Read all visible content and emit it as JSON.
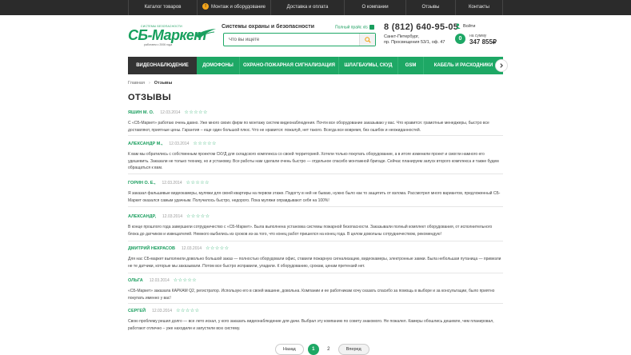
{
  "topnav": [
    {
      "label": "Каталог товаров"
    },
    {
      "label": "Монтаж и оборудование",
      "badge": "!"
    },
    {
      "label": "Доставка и оплата"
    },
    {
      "label": "О компании"
    },
    {
      "label": "Отзывы"
    },
    {
      "label": "Контакты"
    }
  ],
  "logo": {
    "top": "СИСТЕМЫ БЕЗОПАСНОСТИ",
    "main": "СБ-Маркет",
    "sub": "работаем с 2006 года"
  },
  "header": {
    "tagline": "Системы охраны и безопасности",
    "price_link": "Полный прайс xls",
    "phone": "8 (812) 640-95-05",
    "address_line1": "Санкт-Петербург,",
    "address_line2": "пр. Просвещения 53/1, оф. 47",
    "login": "Войти",
    "cart_label": "на сумму",
    "cart_sum": "347 855₽",
    "cart_count": "0"
  },
  "search": {
    "placeholder": "Что вы ищете"
  },
  "catnav": [
    {
      "label": "ВИДЕОНАБЛЮДЕНИЕ"
    },
    {
      "label": "ДОМОФОНЫ"
    },
    {
      "label": "ОХРАНО-ПОЖАРНАЯ СИГНАЛИЗАЦИЯ"
    },
    {
      "label": "ШЛАГБАУМЫ, СКУД"
    },
    {
      "label": "GSM"
    },
    {
      "label": "КАБЕЛЬ И РАСХОДНИКИ"
    }
  ],
  "breadcrumb": {
    "home": "Главная",
    "current": "Отзывы"
  },
  "page_title": "ОТЗЫВЫ",
  "reviews": [
    {
      "author": "ЯШИН М. О.",
      "date": "12.03.2014",
      "rating": 5,
      "text": "С «СБ-Маркет» работаю очень давно. Уже много своих фирм по монтажу систем видеонаблюдения. Почти все оборудование заказываю у вас. Что нравится: грамотные менеджеры, быстро все доставляют, приятные цены. Гарантия – еще один большой плюс. Что не нравится: пожалуй, нет такого. Всегда все вовремя, без ошибок и неожиданностей."
    },
    {
      "author": "АЛЕКСАНДР М.,",
      "date": "12.03.2014",
      "rating": 5,
      "text": "К вам мы обратились с собственным проектом СКУД для складского комплекса со своей территорией. Хотели только покупать оборудование, а в итоге изменили проект и смогли намного его удешевить. Заказали не только технику, но и установку. Все работы нам сделали очень быстро — отдельное спасибо монтажной бригаде. Сейчас планируем запуск второго комплекса и также будем обращаться к вам."
    },
    {
      "author": "ГОРИН О. Е.,",
      "date": "12.03.2014",
      "rating": 5,
      "text": "Я заказал фальшивые видеокамеры, муляжи для своей квартиры на первом этаже. Подогту в ней не бываю, нужно было как то защитить от взлома. Рассмотрел много вариантов, предложенный СБ-Маркет оказался самым удачным. Получилось быстро, недорого. Пока муляжи оправдывают себя на 100%!"
    },
    {
      "author": "АЛЕКСАНДР,",
      "date": "12.03.2014",
      "rating": 5,
      "text": "В конце прошлого года завершили сотрудничество с «СБ-Маркет». Была выполнена установка системы пожарной безопасности. Заказывали полный комплект оборудования, от исполнительного блока до датчиков и извещателей. Немного выбились из сроков из-за того, что конец работ пришелся на конец года. В целом довольны сотрудничеством, рекомендую!"
    },
    {
      "author": "ДМИТРИЙ НЕКРАСОВ",
      "date": "12.03.2014",
      "rating": 5,
      "text": "Для нас СБ-маркет выполнили довольно большой заказ — полностью оборудовали офис, ставили пожарную сигнализацию, видеокамеры, электронные замки. Была небольшая путаница — привезли не те датчики, которые мы заказывали. Потом все быстро исправили, уладили. К оборудованию, срокам, ценам претензий нет."
    },
    {
      "author": "ОЛЬГА",
      "date": "12.03.2014",
      "rating": 5,
      "text": "«СБ-Маркет» заказала КАРКАМ Q2, регистратор. Использую его в своей машине, довольна. Компании и ее работникам хочу сказать спасибо за помощь в выборе и за консультации, было приятно покупать именно у вас!"
    },
    {
      "author": "СЕРГЕЙ",
      "date": "12.03.2014",
      "rating": 5,
      "text": "Свою проблему решил долго — все лето искал, у кого заказать видеонаблюдение для дачи. Выбрал эту компанию по совету знакомого. Не пожалел. Камеры обошлись дешевле, чем планировал, работают отлично – уже находили и запустили всю систему."
    }
  ],
  "pager": {
    "prev": "Назад",
    "pages": [
      "1",
      "2"
    ],
    "current": "1",
    "next": "Вперед"
  },
  "colors": {
    "accent": "#1ea865",
    "topbar": "#2b2b2b",
    "active_tab": "#333333"
  }
}
